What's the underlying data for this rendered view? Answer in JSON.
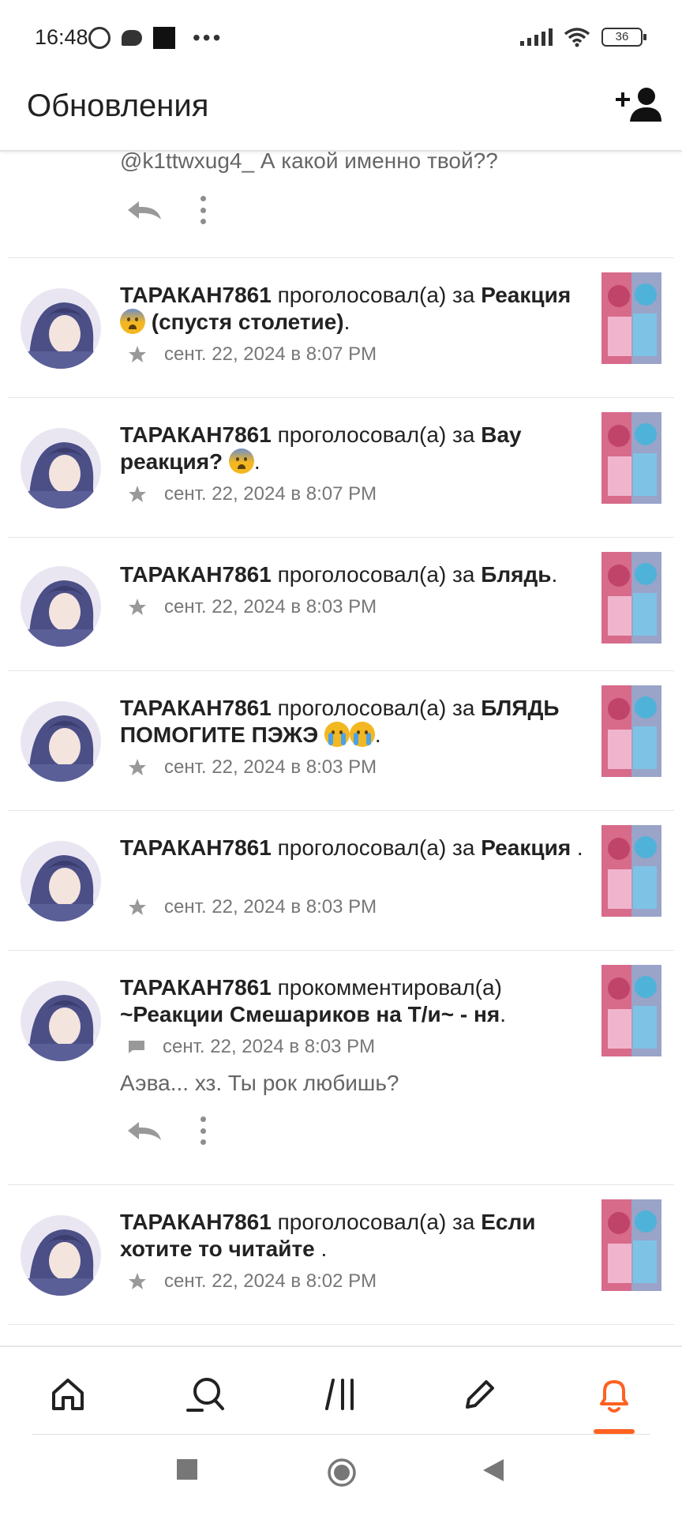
{
  "status_bar": {
    "time": "16:48",
    "battery": "36"
  },
  "header": {
    "title": "Обновления"
  },
  "colors": {
    "accent": "#ff6122",
    "text": "#222222",
    "muted": "#777777"
  },
  "top_partial": {
    "comment": "@k1ttwxug4_ А какой именно твой??"
  },
  "items": [
    {
      "user": "ТАРАКАН7861",
      "action": "проголосовал(а) за",
      "target": "Реакция",
      "emoji": "fear",
      "target_suffix": "(спустя столетие)",
      "end": ".",
      "date": "сент. 22, 2024 в 8:07 PM",
      "meta_icon": "star-icon"
    },
    {
      "user": "ТАРАКАН7861",
      "action": "проголосовал(а) за",
      "target": "Вау реакция?",
      "emoji": "fear",
      "end": ".",
      "date": "сент. 22, 2024 в 8:07 PM",
      "meta_icon": "star-icon"
    },
    {
      "user": "ТАРАКАН7861",
      "action": "проголосовал(а) за",
      "target": "Блядь",
      "end": ".",
      "date": "сент. 22, 2024 в 8:03 PM",
      "meta_icon": "star-icon"
    },
    {
      "user": "ТАРАКАН7861",
      "action": "проголосовал(а) за",
      "target": "БЛЯДЬ ПОМОГИТЕ ПЭЖЭ",
      "emoji": "cry",
      "end": ".",
      "date": "сент. 22, 2024 в 8:03 PM",
      "meta_icon": "star-icon"
    },
    {
      "user": "ТАРАКАН7861",
      "action": "проголосовал(а) за",
      "target": "Реакция",
      "end": " .",
      "date": "сент. 22, 2024 в 8:03 PM",
      "meta_icon": "star-icon"
    },
    {
      "user": "ТАРАКАН7861",
      "action": "прокомментировал(а)",
      "target": "~Реакции Смешариков на Т/и~ - ня",
      "end": ".",
      "date": "сент. 22, 2024 в 8:03 PM",
      "meta_icon": "comment-icon",
      "comment": "Аэва... хз. Ты рок любишь?"
    },
    {
      "user": "ТАРАКАН7861",
      "action": "проголосовал(а) за",
      "target": "Если хотите то читайте",
      "end": " .",
      "date": "сент. 22, 2024 в 8:02 PM",
      "meta_icon": "star-icon"
    }
  ]
}
